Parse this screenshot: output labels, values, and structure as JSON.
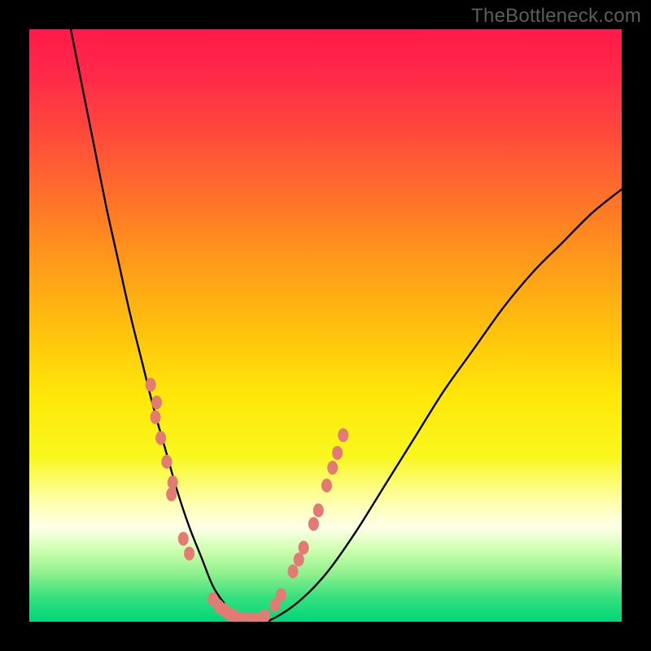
{
  "watermark": "TheBottleneck.com",
  "chart_data": {
    "type": "line",
    "title": "",
    "xlabel": "",
    "ylabel": "",
    "xlim": [
      0,
      100
    ],
    "ylim": [
      0,
      100
    ],
    "gradient_stops": [
      {
        "offset": 0.0,
        "color": "#ff1a4b"
      },
      {
        "offset": 0.08,
        "color": "#ff2a49"
      },
      {
        "offset": 0.2,
        "color": "#ff5238"
      },
      {
        "offset": 0.35,
        "color": "#ff8a20"
      },
      {
        "offset": 0.5,
        "color": "#ffbf0e"
      },
      {
        "offset": 0.62,
        "color": "#ffe709"
      },
      {
        "offset": 0.72,
        "color": "#f9f71d"
      },
      {
        "offset": 0.8,
        "color": "#ffffb0"
      },
      {
        "offset": 0.84,
        "color": "#ffffe8"
      },
      {
        "offset": 0.88,
        "color": "#ccffad"
      },
      {
        "offset": 0.92,
        "color": "#8cf08c"
      },
      {
        "offset": 0.96,
        "color": "#33e07e"
      },
      {
        "offset": 1.0,
        "color": "#00d67a"
      }
    ],
    "series": [
      {
        "name": "bottleneck-curve",
        "x": [
          7,
          9,
          11,
          13,
          15,
          17,
          19,
          21,
          23,
          25,
          27,
          29,
          31,
          33,
          35,
          37,
          40,
          45,
          50,
          55,
          60,
          65,
          70,
          75,
          80,
          85,
          90,
          95,
          100
        ],
        "y": [
          100,
          90,
          80,
          70,
          61,
          52,
          44,
          36,
          29,
          22,
          16,
          11,
          6,
          3,
          1,
          0,
          0,
          3,
          8,
          15,
          23,
          31,
          39,
          46,
          53,
          59,
          64,
          69,
          73
        ]
      }
    ],
    "markers": [
      {
        "name": "left-cluster",
        "points": [
          [
            20.5,
            40
          ],
          [
            21.5,
            37
          ],
          [
            21.3,
            34.5
          ],
          [
            22.2,
            31
          ],
          [
            23.2,
            27
          ],
          [
            24.2,
            23.5
          ],
          [
            24.0,
            21.5
          ],
          [
            26.0,
            14
          ],
          [
            27.0,
            11.5
          ],
          [
            31.0,
            3.8
          ],
          [
            32.0,
            2.6
          ],
          [
            32.8,
            2.0
          ],
          [
            33.6,
            1.4
          ],
          [
            34.4,
            1.0
          ],
          [
            35.2,
            0.6
          ],
          [
            36.0,
            0.4
          ],
          [
            36.8,
            0.4
          ],
          [
            37.6,
            0.4
          ],
          [
            38.4,
            0.4
          ]
        ]
      },
      {
        "name": "right-cluster",
        "points": [
          [
            39.8,
            1.0
          ],
          [
            41.5,
            2.8
          ],
          [
            42.5,
            4.5
          ],
          [
            44.5,
            8.5
          ],
          [
            45.5,
            10.5
          ],
          [
            46.3,
            12.5
          ],
          [
            48.0,
            16.5
          ],
          [
            48.8,
            18.8
          ],
          [
            50.2,
            23.0
          ],
          [
            51.2,
            26.0
          ],
          [
            52.0,
            28.5
          ],
          [
            53.0,
            31.5
          ]
        ]
      }
    ],
    "marker_style": {
      "fill": "#e37a73",
      "rx": 6.5,
      "ry": 8.5
    }
  }
}
